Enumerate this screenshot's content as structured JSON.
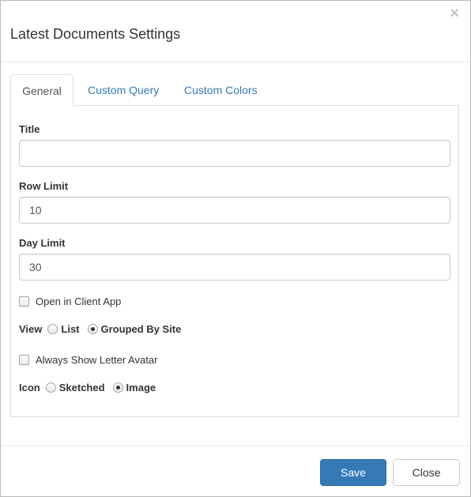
{
  "dialog": {
    "title": "Latest Documents Settings",
    "close_glyph": "×"
  },
  "tabs": [
    {
      "label": "General",
      "active": true
    },
    {
      "label": "Custom Query",
      "active": false
    },
    {
      "label": "Custom Colors",
      "active": false
    }
  ],
  "form": {
    "title_label": "Title",
    "title_value": "",
    "row_limit_label": "Row Limit",
    "row_limit_value": "10",
    "day_limit_label": "Day Limit",
    "day_limit_value": "30",
    "open_client_label": "Open in Client App",
    "open_client_checked": false,
    "view_label": "View",
    "view_options": [
      {
        "label": "List",
        "checked": false
      },
      {
        "label": "Grouped By Site",
        "checked": true
      }
    ],
    "avatar_label": "Always Show Letter Avatar",
    "avatar_checked": false,
    "icon_label": "Icon",
    "icon_options": [
      {
        "label": "Sketched",
        "checked": false
      },
      {
        "label": "Image",
        "checked": true
      }
    ]
  },
  "footer": {
    "save_label": "Save",
    "close_label": "Close"
  },
  "colors": {
    "primary": "#337ab7",
    "link": "#337ab7"
  }
}
